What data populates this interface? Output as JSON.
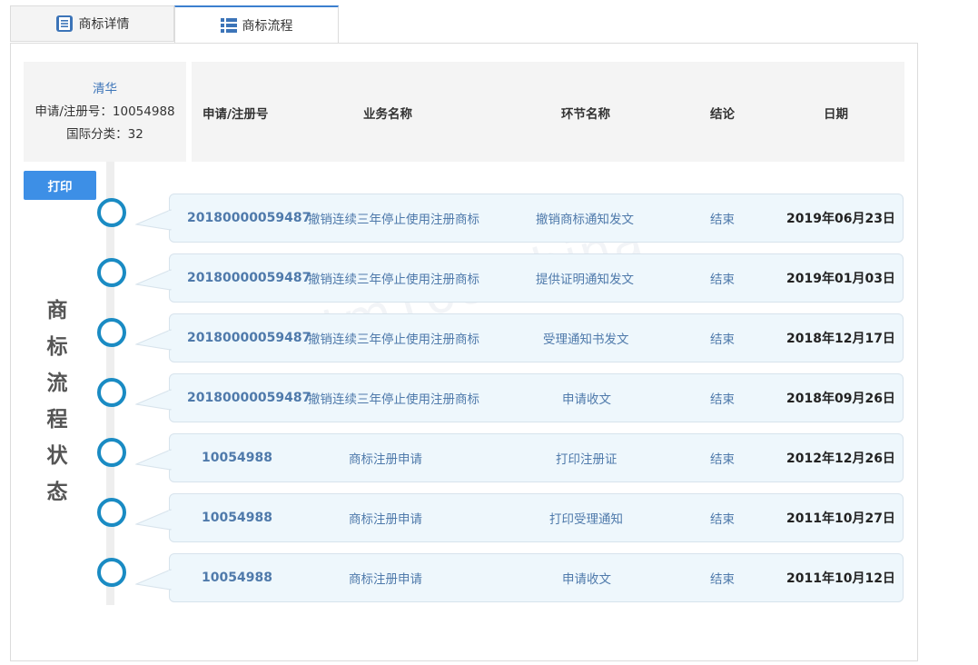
{
  "tabs": [
    {
      "label": "商标详情",
      "icon": "document-list-icon",
      "active": false
    },
    {
      "label": "商标流程",
      "icon": "list-icon",
      "active": true
    }
  ],
  "info": {
    "name": "清华",
    "reg_line": "申请/注册号：10054988",
    "class_line": "国际分类：32"
  },
  "table": {
    "headers": [
      "申请/注册号",
      "业务名称",
      "环节名称",
      "结论",
      "日期"
    ],
    "rows": [
      {
        "number": "20180000059487",
        "business": "撤销连续三年停止使用注册商标",
        "step": "撤销商标通知发文",
        "result": "结束",
        "date": "2019年06月23日"
      },
      {
        "number": "20180000059487",
        "business": "撤销连续三年停止使用注册商标",
        "step": "提供证明通知发文",
        "result": "结束",
        "date": "2019年01月03日"
      },
      {
        "number": "20180000059487",
        "business": "撤销连续三年停止使用注册商标",
        "step": "受理通知书发文",
        "result": "结束",
        "date": "2018年12月17日"
      },
      {
        "number": "20180000059487",
        "business": "撤销连续三年停止使用注册商标",
        "step": "申请收文",
        "result": "结束",
        "date": "2018年09月26日"
      },
      {
        "number": "10054988",
        "business": "商标注册申请",
        "step": "打印注册证",
        "result": "结束",
        "date": "2012年12月26日"
      },
      {
        "number": "10054988",
        "business": "商标注册申请",
        "step": "打印受理通知",
        "result": "结束",
        "date": "2011年10月27日"
      },
      {
        "number": "10054988",
        "business": "商标注册申请",
        "step": "申请收文",
        "result": "结束",
        "date": "2011年10月12日"
      }
    ]
  },
  "print_label": "打印",
  "vertical_title": [
    "商",
    "标",
    "流",
    "程",
    "状",
    "态"
  ],
  "watermark": {
    "text": "tm168-china",
    "brand_cn": "国韬智软",
    "brand_en": "ao Zhiruan"
  },
  "colors": {
    "accent": "#3d8fe6",
    "timeline_ring": "#1a8bc3",
    "row_bg": "#eef7fc",
    "link_text": "#4f7aab"
  }
}
